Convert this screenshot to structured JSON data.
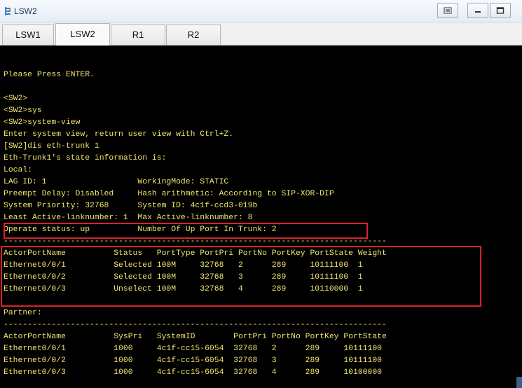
{
  "window": {
    "title": "LSW2",
    "icon": "network-device-icon",
    "buttons": [
      "restore-icon",
      "minimize-icon",
      "maximize-icon"
    ]
  },
  "tabs": [
    {
      "label": "LSW1",
      "active": false
    },
    {
      "label": "LSW2",
      "active": true
    },
    {
      "label": "R1",
      "active": false
    },
    {
      "label": "R2",
      "active": false
    }
  ],
  "colors": {
    "terminal_background": "#000000",
    "terminal_text": "#f1e46f",
    "highlight_border": "#d9232c"
  },
  "terminal": {
    "lines": [
      "Please Press ENTER.",
      "",
      "<SW2>",
      "<SW2>sys",
      "<SW2>system-view",
      "Enter system view, return user view with Ctrl+Z.",
      "[SW2]dis eth-trunk 1",
      "Eth-Trunk1's state information is:",
      "Local:",
      "LAG ID: 1                   WorkingMode: STATIC",
      "Preempt Delay: Disabled     Hash arithmetic: According to SIP-XOR-DIP",
      "System Priority: 32768      System ID: 4c1f-ccd3-019b",
      "Least Active-linknumber: 1  Max Active-linknumber: 8",
      "Operate status: up          Number Of Up Port In Trunk: 2",
      "--------------------------------------------------------------------------------",
      "ActorPortName          Status   PortType PortPri PortNo PortKey PortState Weight",
      "Ethernet0/0/1          Selected 100M     32768   2      289     10111100  1",
      "Ethernet0/0/2          Selected 100M     32768   3      289     10111100  1",
      "Ethernet0/0/3          Unselect 100M     32768   4      289     10110000  1",
      "",
      "Partner:",
      "--------------------------------------------------------------------------------",
      "ActorPortName          SysPri   SystemID        PortPri PortNo PortKey PortState",
      "Ethernet0/0/1          1000     4c1f-cc15-6054  32768   2      289     10111100",
      "Ethernet0/0/2          1000     4c1f-cc15-6054  32768   3      289     10111100",
      "Ethernet0/0/3          1000     4c1f-cc15-6054  32768   4      289     10100000"
    ]
  }
}
